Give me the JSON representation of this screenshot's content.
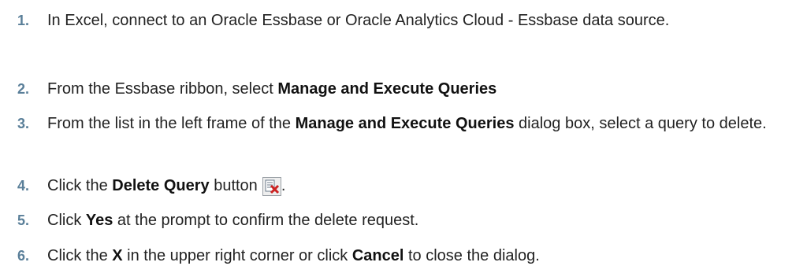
{
  "steps": [
    {
      "number": "1.",
      "text": "In Excel, connect to an Oracle Essbase or Oracle Analytics Cloud - Essbase data source."
    },
    {
      "number": "2.",
      "pre": "From the Essbase ribbon, select ",
      "bold": "Manage and Execute Queries"
    },
    {
      "number": "3.",
      "pre": "From the list in the left frame of the ",
      "bold": "Manage and Execute Queries",
      "post": " dialog box, select a query to delete."
    },
    {
      "number": "4.",
      "pre": "Click the ",
      "bold": "Delete Query",
      "post": " button",
      "icon": "delete-query-icon",
      "end": "."
    },
    {
      "number": "5.",
      "pre": "Click ",
      "bold": "Yes",
      "post": " at the prompt to confirm the delete request."
    },
    {
      "number": "6.",
      "pre": "Click the ",
      "bold": "X",
      "mid": " in the upper right corner or click ",
      "bold2": "Cancel",
      "post": " to close the dialog."
    }
  ],
  "colors": {
    "step_number": "#5a7f99",
    "text": "#222222",
    "icon_red": "#cc2222"
  }
}
